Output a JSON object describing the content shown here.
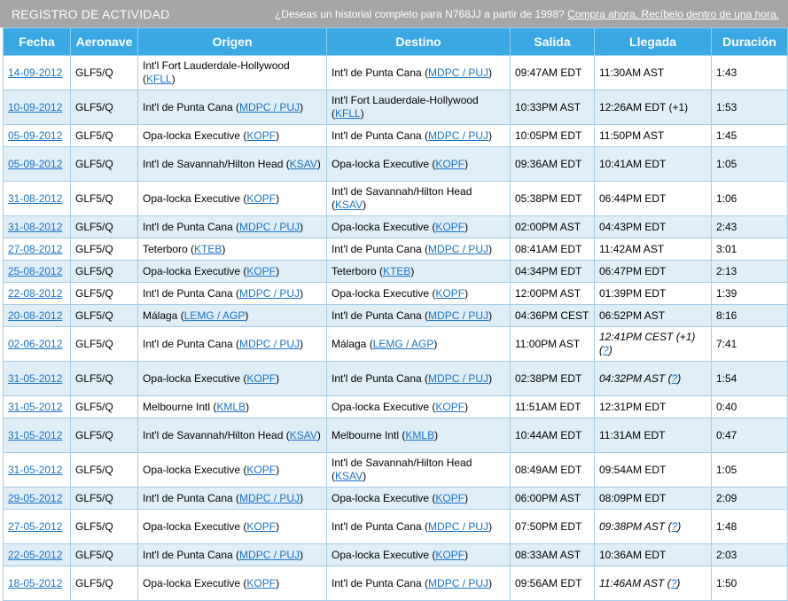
{
  "header": {
    "title": "REGISTRO DE ACTIVIDAD",
    "promo_text": "¿Deseas un historial completo para N768JJ a partir de 1998?",
    "promo_link": "Compra ahora. Recíbelo dentro de una hora."
  },
  "columns": [
    "Fecha",
    "Aeronave",
    "Origen",
    "Destino",
    "Salida",
    "Llegada",
    "Duración"
  ],
  "rows": [
    {
      "date": "14-09-2012",
      "aircraft": "GLF5/Q",
      "orig_name": "Int'l Fort Lauderdale-Hollywood",
      "orig_code": "KFLL",
      "dest_name": "Int'l de Punta Cana",
      "dest_code": "MDPC / PUJ",
      "dep": "09:47AM EDT",
      "arr": "11:30AM AST",
      "arr_q": "",
      "dur": "1:43"
    },
    {
      "date": "10-09-2012",
      "aircraft": "GLF5/Q",
      "orig_name": "Int'l de Punta Cana",
      "orig_code": "MDPC / PUJ",
      "dest_name": "Int'l Fort Lauderdale-Hollywood",
      "dest_code": "KFLL",
      "dep": "10:33PM AST",
      "arr": "12:26AM EDT (+1)",
      "arr_q": "",
      "dur": "1:53"
    },
    {
      "date": "05-09-2012",
      "aircraft": "GLF5/Q",
      "orig_name": "Opa-locka Executive",
      "orig_code": "KOPF",
      "dest_name": "Int'l de Punta Cana",
      "dest_code": "MDPC / PUJ",
      "dep": "10:05PM EDT",
      "arr": "11:50PM AST",
      "arr_q": "",
      "dur": "1:45"
    },
    {
      "date": "05-09-2012",
      "aircraft": "GLF5/Q",
      "orig_name": "Int'l de Savannah/Hilton Head",
      "orig_code": "KSAV",
      "dest_name": "Opa-locka Executive",
      "dest_code": "KOPF",
      "dep": "09:36AM EDT",
      "arr": "10:41AM EDT",
      "arr_q": "",
      "dur": "1:05"
    },
    {
      "date": "31-08-2012",
      "aircraft": "GLF5/Q",
      "orig_name": "Opa-locka Executive",
      "orig_code": "KOPF",
      "dest_name": "Int'l de Savannah/Hilton Head",
      "dest_code": "KSAV",
      "dep": "05:38PM EDT",
      "arr": "06:44PM EDT",
      "arr_q": "",
      "dur": "1:06"
    },
    {
      "date": "31-08-2012",
      "aircraft": "GLF5/Q",
      "orig_name": "Int'l de Punta Cana",
      "orig_code": "MDPC / PUJ",
      "dest_name": "Opa-locka Executive",
      "dest_code": "KOPF",
      "dep": "02:00PM AST",
      "arr": "04:43PM EDT",
      "arr_q": "",
      "dur": "2:43"
    },
    {
      "date": "27-08-2012",
      "aircraft": "GLF5/Q",
      "orig_name": "Teterboro",
      "orig_code": "KTEB",
      "dest_name": "Int'l de Punta Cana",
      "dest_code": "MDPC / PUJ",
      "dep": "08:41AM EDT",
      "arr": "11:42AM AST",
      "arr_q": "",
      "dur": "3:01"
    },
    {
      "date": "25-08-2012",
      "aircraft": "GLF5/Q",
      "orig_name": "Opa-locka Executive",
      "orig_code": "KOPF",
      "dest_name": "Teterboro",
      "dest_code": "KTEB",
      "dep": "04:34PM EDT",
      "arr": "06:47PM EDT",
      "arr_q": "",
      "dur": "2:13"
    },
    {
      "date": "22-08-2012",
      "aircraft": "GLF5/Q",
      "orig_name": "Int'l de Punta Cana",
      "orig_code": "MDPC / PUJ",
      "dest_name": "Opa-locka Executive",
      "dest_code": "KOPF",
      "dep": "12:00PM AST",
      "arr": "01:39PM EDT",
      "arr_q": "",
      "dur": "1:39"
    },
    {
      "date": "20-08-2012",
      "aircraft": "GLF5/Q",
      "orig_name": "Málaga",
      "orig_code": "LEMG / AGP",
      "dest_name": "Int'l de Punta Cana",
      "dest_code": "MDPC / PUJ",
      "dep": "04:36PM CEST",
      "arr": "06:52PM AST",
      "arr_q": "",
      "dur": "8:16"
    },
    {
      "date": "02-06-2012",
      "aircraft": "GLF5/Q",
      "orig_name": "Int'l de Punta Cana",
      "orig_code": "MDPC / PUJ",
      "dest_name": "Málaga",
      "dest_code": "LEMG / AGP",
      "dep": "11:00PM AST",
      "arr": "12:41PM CEST (+1)",
      "arr_q": "?",
      "dur": "7:41"
    },
    {
      "date": "31-05-2012",
      "aircraft": "GLF5/Q",
      "orig_name": "Opa-locka Executive",
      "orig_code": "KOPF",
      "dest_name": "Int'l de Punta Cana",
      "dest_code": "MDPC / PUJ",
      "dep": "02:38PM EDT",
      "arr": "04:32PM AST",
      "arr_q": "?",
      "dur": "1:54"
    },
    {
      "date": "31-05-2012",
      "aircraft": "GLF5/Q",
      "orig_name": "Melbourne Intl",
      "orig_code": "KMLB",
      "dest_name": "Opa-locka Executive",
      "dest_code": "KOPF",
      "dep": "11:51AM EDT",
      "arr": "12:31PM EDT",
      "arr_q": "",
      "dur": "0:40"
    },
    {
      "date": "31-05-2012",
      "aircraft": "GLF5/Q",
      "orig_name": "Int'l de Savannah/Hilton Head",
      "orig_code": "KSAV",
      "dest_name": "Melbourne Intl",
      "dest_code": "KMLB",
      "dep": "10:44AM EDT",
      "arr": "11:31AM EDT",
      "arr_q": "",
      "dur": "0:47"
    },
    {
      "date": "31-05-2012",
      "aircraft": "GLF5/Q",
      "orig_name": "Opa-locka Executive",
      "orig_code": "KOPF",
      "dest_name": "Int'l de Savannah/Hilton Head",
      "dest_code": "KSAV",
      "dep": "08:49AM EDT",
      "arr": "09:54AM EDT",
      "arr_q": "",
      "dur": "1:05"
    },
    {
      "date": "29-05-2012",
      "aircraft": "GLF5/Q",
      "orig_name": "Int'l de Punta Cana",
      "orig_code": "MDPC / PUJ",
      "dest_name": "Opa-locka Executive",
      "dest_code": "KOPF",
      "dep": "06:00PM AST",
      "arr": "08:09PM EDT",
      "arr_q": "",
      "dur": "2:09"
    },
    {
      "date": "27-05-2012",
      "aircraft": "GLF5/Q",
      "orig_name": "Opa-locka Executive",
      "orig_code": "KOPF",
      "dest_name": "Int'l de Punta Cana",
      "dest_code": "MDPC / PUJ",
      "dep": "07:50PM EDT",
      "arr": "09:38PM AST",
      "arr_q": "?",
      "dur": "1:48"
    },
    {
      "date": "22-05-2012",
      "aircraft": "GLF5/Q",
      "orig_name": "Int'l de Punta Cana",
      "orig_code": "MDPC / PUJ",
      "dest_name": "Opa-locka Executive",
      "dest_code": "KOPF",
      "dep": "08:33AM AST",
      "arr": "10:36AM EDT",
      "arr_q": "",
      "dur": "2:03"
    },
    {
      "date": "18-05-2012",
      "aircraft": "GLF5/Q",
      "orig_name": "Opa-locka Executive",
      "orig_code": "KOPF",
      "dest_name": "Int'l de Punta Cana",
      "dest_code": "MDPC / PUJ",
      "dep": "09:56AM EDT",
      "arr": "11:46AM AST",
      "arr_q": "?",
      "dur": "1:50"
    }
  ]
}
